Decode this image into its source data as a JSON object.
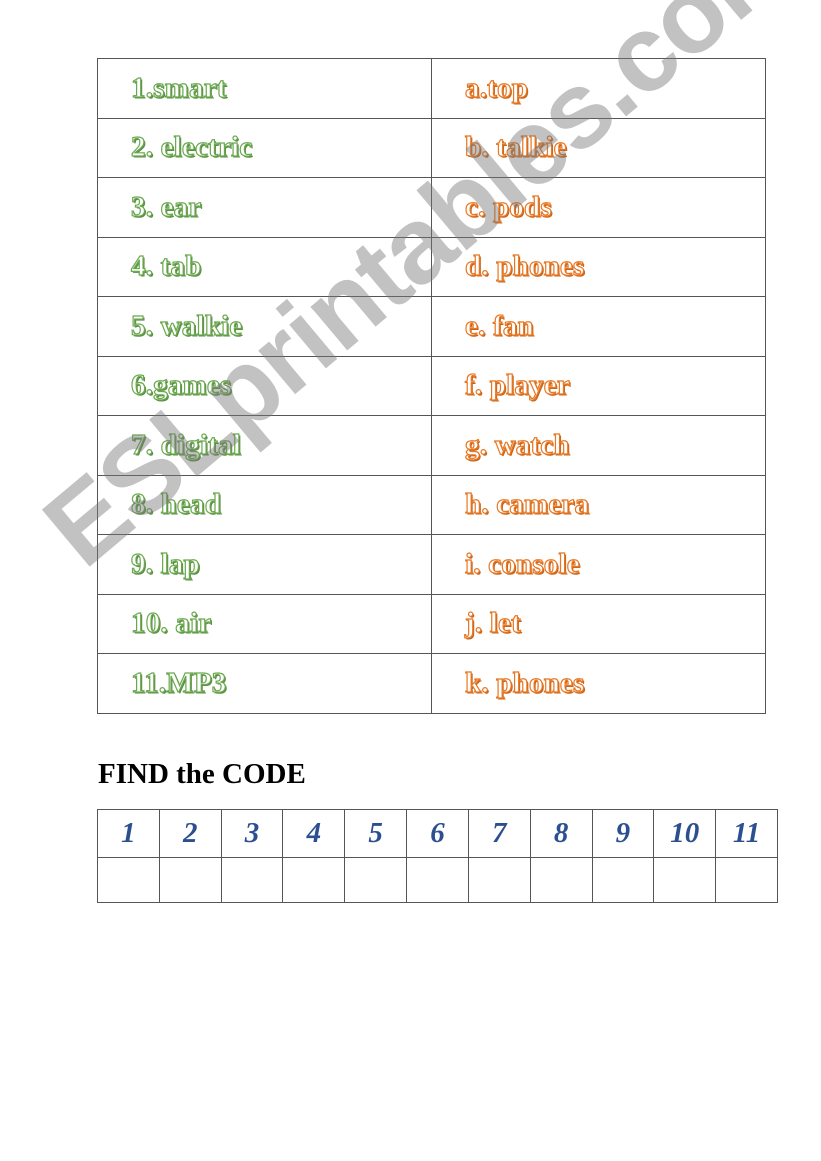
{
  "matching": {
    "rows": [
      {
        "left": "1.smart",
        "right": "a.top"
      },
      {
        "left": "2. electric",
        "right": "b. talkie"
      },
      {
        "left": "3. ear",
        "right": "c. pods"
      },
      {
        "left": "4. tab",
        "right": "d. phones"
      },
      {
        "left": "5. walkie",
        "right": "e. fan"
      },
      {
        "left": "6.games",
        "right": "f. player"
      },
      {
        "left": "7. digital",
        "right": "g. watch"
      },
      {
        "left": "8. head",
        "right": "h. camera"
      },
      {
        "left": "9. lap",
        "right": "i. console"
      },
      {
        "left": "10. air",
        "right": "j. let"
      },
      {
        "left": "11.MP3",
        "right": "k. phones"
      }
    ],
    "colors": {
      "left": "#6aa84f",
      "right": "#e87722"
    }
  },
  "code_section": {
    "title": "FIND the CODE",
    "numbers": [
      "1",
      "2",
      "3",
      "4",
      "5",
      "6",
      "7",
      "8",
      "9",
      "10",
      "11"
    ],
    "answers": [
      "",
      "",
      "",
      "",
      "",
      "",
      "",
      "",
      "",
      "",
      ""
    ],
    "number_color": "#2c4f8f"
  },
  "watermark": {
    "text": "ESLprintables.com"
  }
}
